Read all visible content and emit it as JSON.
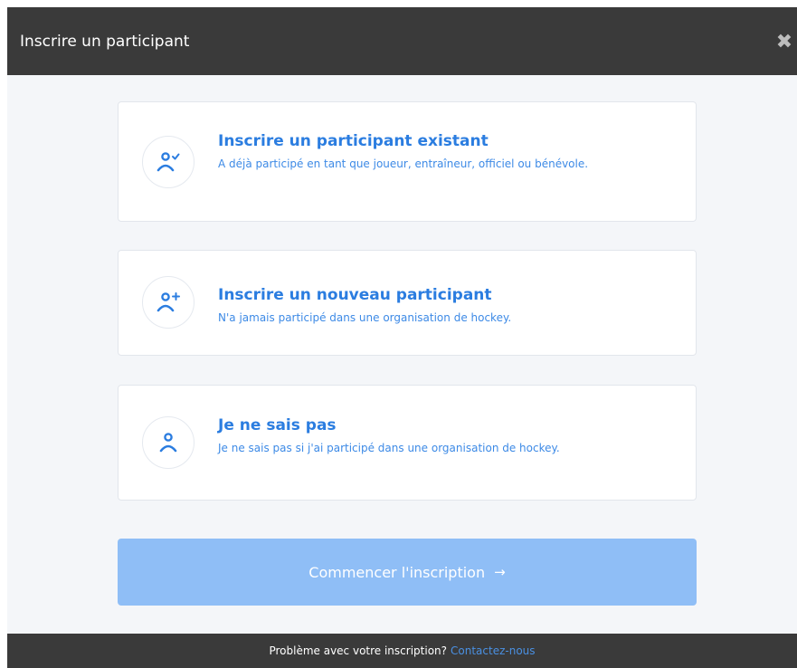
{
  "header": {
    "title": "Inscrire un participant",
    "close_icon": "close-icon"
  },
  "options": [
    {
      "title": "Inscrire un participant existant",
      "description": "A déjà participé en tant que joueur, entraîneur, officiel ou bénévole.",
      "icon": "user-check-icon"
    },
    {
      "title": "Inscrire un nouveau participant",
      "description": "N'a jamais participé dans une organisation de hockey.",
      "icon": "user-plus-icon"
    },
    {
      "title": "Je ne sais pas",
      "description": "Je ne sais pas si j'ai participé dans une organisation de hockey.",
      "icon": "user-icon"
    }
  ],
  "start_button": {
    "label": "Commencer l'inscription",
    "arrow": "→"
  },
  "footer": {
    "text": "Problème avec votre inscription?",
    "link": "Contactez-nous"
  },
  "colors": {
    "header_bg": "#3a3a3a",
    "accent": "#2b7de0",
    "button_bg": "#8fbef6",
    "body_bg": "#f4f6f9"
  }
}
